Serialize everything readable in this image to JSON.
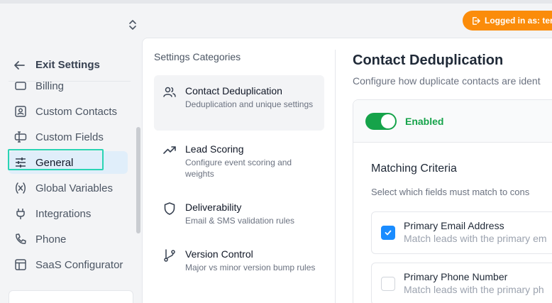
{
  "colors": {
    "accent_orange": "#fb8c0a",
    "active_bg": "#e0eefa",
    "focus_outline": "#2ad4b4",
    "toggle_green": "#16a34a",
    "checkbox_blue": "#1a8cff"
  },
  "header": {
    "login_label": "Logged in as: ter",
    "logout_icon": "logout-icon",
    "switcher_icon": "chevron-up-down-icon"
  },
  "sidebar": {
    "exit_label": "Exit Settings",
    "items": [
      {
        "label": "Billing",
        "icon": "billing-icon"
      },
      {
        "label": "Custom Contacts",
        "icon": "contact-card-icon"
      },
      {
        "label": "Custom Fields",
        "icon": "custom-field-icon"
      },
      {
        "label": "General",
        "icon": "sliders-icon",
        "active": true
      },
      {
        "label": "Global Variables",
        "icon": "variable-icon"
      },
      {
        "label": "Integrations",
        "icon": "plug-icon"
      },
      {
        "label": "Phone",
        "icon": "phone-icon"
      },
      {
        "label": "SaaS Configurator",
        "icon": "layout-icon"
      }
    ]
  },
  "categories": {
    "title": "Settings Categories",
    "items": [
      {
        "name": "Contact Deduplication",
        "desc": "Deduplication and unique settings",
        "icon": "users-icon",
        "selected": true
      },
      {
        "name": "Lead Scoring",
        "desc": "Configure event scoring and weights",
        "icon": "trending-up-icon"
      },
      {
        "name": "Deliverability",
        "desc": "Email & SMS validation rules",
        "icon": "shield-icon"
      },
      {
        "name": "Version Control",
        "desc": "Major vs minor version bump rules",
        "icon": "git-branch-icon"
      }
    ]
  },
  "content": {
    "title": "Contact Deduplication",
    "subtitle": "Configure how duplicate contacts are ident",
    "toggle_label": "Enabled",
    "toggle_on": true,
    "matching": {
      "title": "Matching Criteria",
      "subtitle": "Select which fields must match to cons",
      "criteria": [
        {
          "name": "Primary Email Address",
          "desc": "Match leads with the primary em",
          "checked": true
        },
        {
          "name": "Primary Phone Number",
          "desc": "Match leads with the primary ph",
          "checked": false
        }
      ]
    }
  }
}
